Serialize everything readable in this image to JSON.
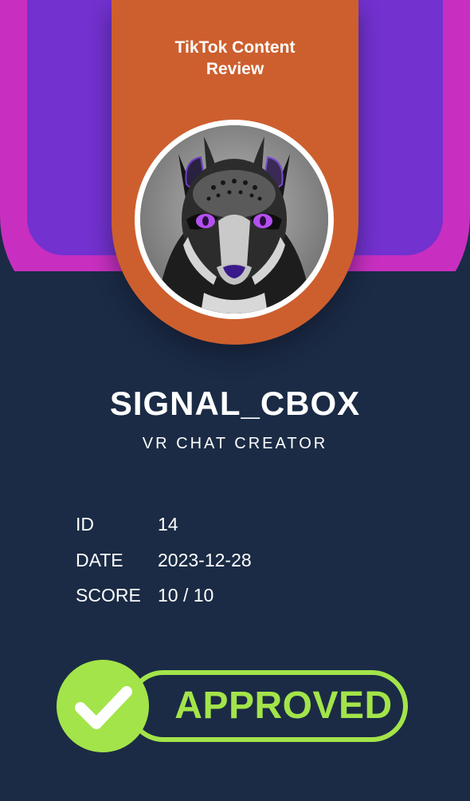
{
  "banner": {
    "title_line1": "TikTok Content",
    "title_line2": "Review"
  },
  "profile": {
    "name": "SIGNAL_CBOX",
    "role": "VR CHAT CREATOR"
  },
  "details": [
    {
      "label": "ID",
      "value": "14"
    },
    {
      "label": "DATE",
      "value": "2023-12-28"
    },
    {
      "label": "SCORE",
      "value": "10 / 10"
    }
  ],
  "status": {
    "label": "APPROVED",
    "icon": "check-icon"
  },
  "colors": {
    "background": "#1b2b45",
    "banner": "#cd5f2e",
    "violet": "#7331cf",
    "magenta": "#c82fc0",
    "approved": "#a3e44a"
  }
}
